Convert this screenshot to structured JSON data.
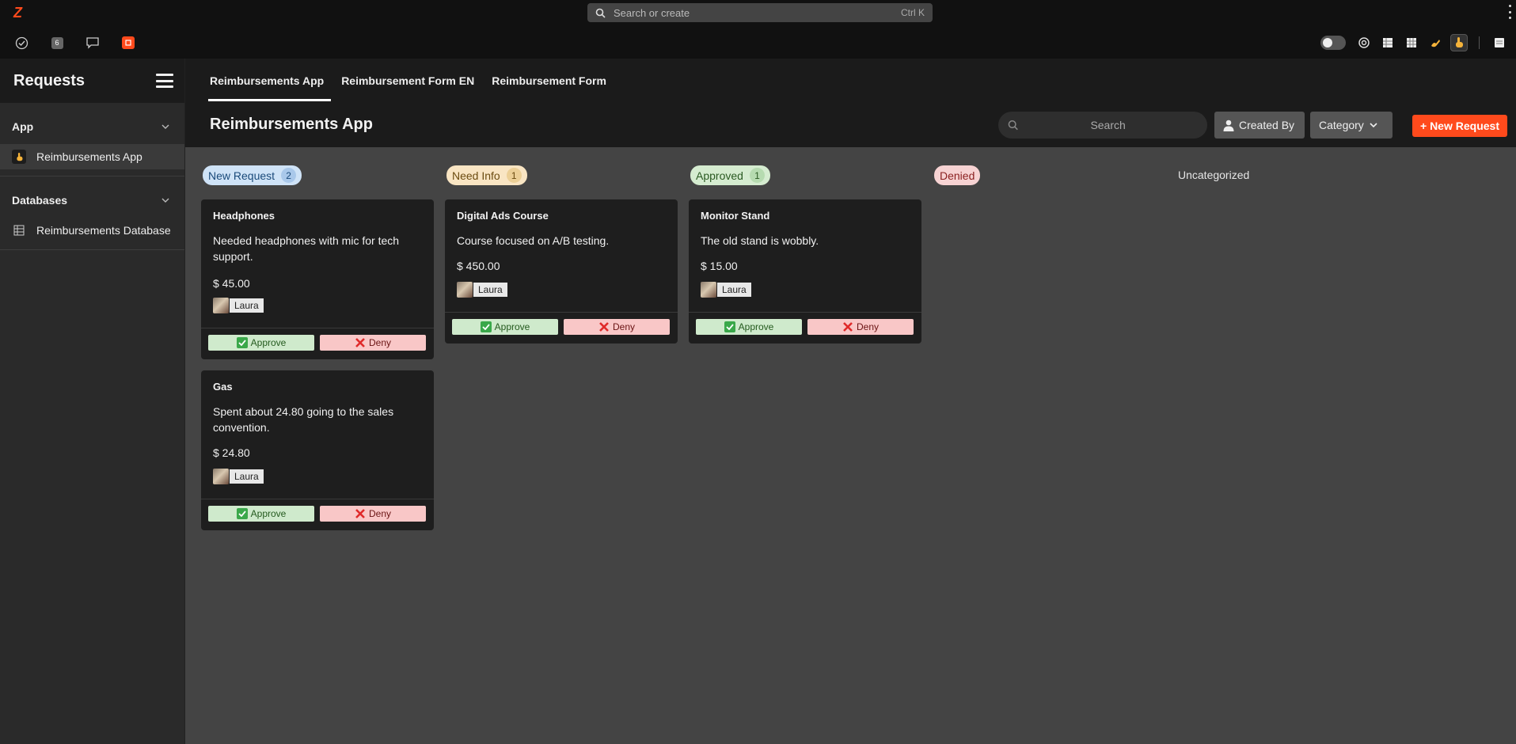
{
  "topbar": {
    "search_placeholder": "Search or create",
    "shortcut": "Ctrl K",
    "toolbar_badge": "6"
  },
  "sidebar": {
    "title": "Requests",
    "sections": [
      {
        "label": "App",
        "items": [
          {
            "label": "Reimbursements App",
            "icon": "pointing-hand-icon"
          }
        ]
      },
      {
        "label": "Databases",
        "items": [
          {
            "label": "Reimbursements Database",
            "icon": "table-icon"
          }
        ]
      }
    ]
  },
  "tabs": [
    "Reimbursements App",
    "Reimbursement Form EN",
    "Reimbursement Form"
  ],
  "header": {
    "title": "Reimbursements App",
    "search_placeholder": "Search",
    "created_by_label": "Created By",
    "category_label": "Category",
    "new_request_label": "+ New Request"
  },
  "columns": [
    {
      "label": "New Request",
      "count": "2",
      "color": "#cfe3f7"
    },
    {
      "label": "Need Info",
      "count": "1",
      "color": "#f9e5c3"
    },
    {
      "label": "Approved",
      "count": "1",
      "color": "#d5ecd0"
    },
    {
      "label": "Denied",
      "color": "#f7d3d3"
    },
    {
      "label": "Uncategorized"
    }
  ],
  "cards": [
    {
      "title": "Headphones",
      "description": "Needed headphones with mic for tech support.",
      "amount": "$ 45.00",
      "user": "Laura"
    },
    {
      "title": "Gas",
      "description": "Spent about 24.80 going to the sales convention.",
      "amount": "$ 24.80",
      "user": "Laura"
    },
    {
      "title": "Digital Ads Course",
      "description": "Course focused on A/B testing.",
      "amount": "$ 450.00",
      "user": "Laura"
    },
    {
      "title": "Monitor Stand",
      "description": "The old stand is wobbly.",
      "amount": "$ 15.00",
      "user": "Laura"
    }
  ],
  "actions": {
    "approve": "Approve",
    "deny": "Deny"
  },
  "colors": {
    "accent": "#ff4a1c",
    "approve_bg": "#cfeacc",
    "deny_bg": "#f9c7c7"
  }
}
